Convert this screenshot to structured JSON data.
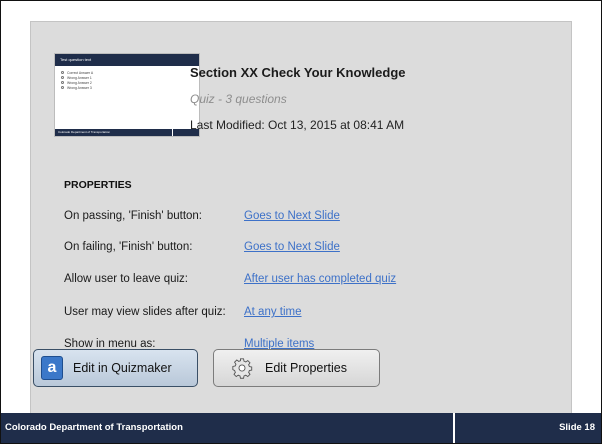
{
  "quiz": {
    "title": "Section XX Check Your Knowledge",
    "subtitle": "Quiz - 3 questions",
    "last_modified": "Last Modified: Oct 13, 2015 at 08:41 AM"
  },
  "thumbnail": {
    "header": "Test question text",
    "options": [
      "Correct Answer A",
      "Wrong Answer 1",
      "Wrong Answer 2",
      "Wrong Answer 3"
    ],
    "footer": "Colorado Department of Transportation"
  },
  "properties": {
    "heading": "PROPERTIES",
    "rows": [
      {
        "label": "On passing, 'Finish' button:",
        "value": "Goes to Next Slide"
      },
      {
        "label": "On failing, 'Finish' button:",
        "value": "Goes to Next Slide"
      },
      {
        "label": "Allow user to leave quiz:",
        "value": "After user has completed quiz"
      },
      {
        "label": "User may view slides after quiz:",
        "value": "At any time"
      },
      {
        "label": "Show in menu as:",
        "value": "Multiple items"
      }
    ]
  },
  "buttons": {
    "edit_quizmaker": "Edit in Quizmaker",
    "edit_properties": "Edit Properties",
    "quizmaker_icon_glyph": "a",
    "quizmaker_icon": "quizmaker-app-icon",
    "properties_icon": "gear-icon"
  },
  "footer": {
    "organization": "Colorado Department of Transportation",
    "slide_label": "Slide 18"
  },
  "colors": {
    "footer_bg": "#1f2d4a",
    "link": "#3d71c8",
    "panel_bg": "#dcdcdc",
    "quizmaker_icon_bg": "#3b78c9"
  }
}
